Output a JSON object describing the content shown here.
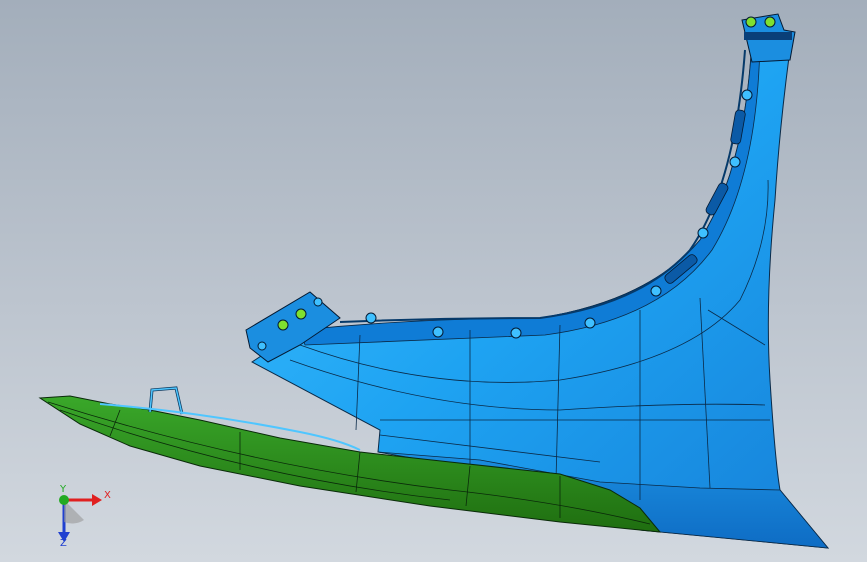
{
  "viewport": {
    "background_top": "#a3aebb",
    "background_bottom": "#d2d8df"
  },
  "model": {
    "parts": [
      {
        "name": "fender-panel",
        "color": "#1ea3f2"
      },
      {
        "name": "lower-trim",
        "color": "#2c8a14"
      }
    ],
    "edge_color": "#0a2a48"
  },
  "triad": {
    "x_label": "X",
    "y_label": "Y",
    "z_label": "Z",
    "x_color": "#e02020",
    "y_color": "#22aa22",
    "z_color": "#2040d0"
  }
}
